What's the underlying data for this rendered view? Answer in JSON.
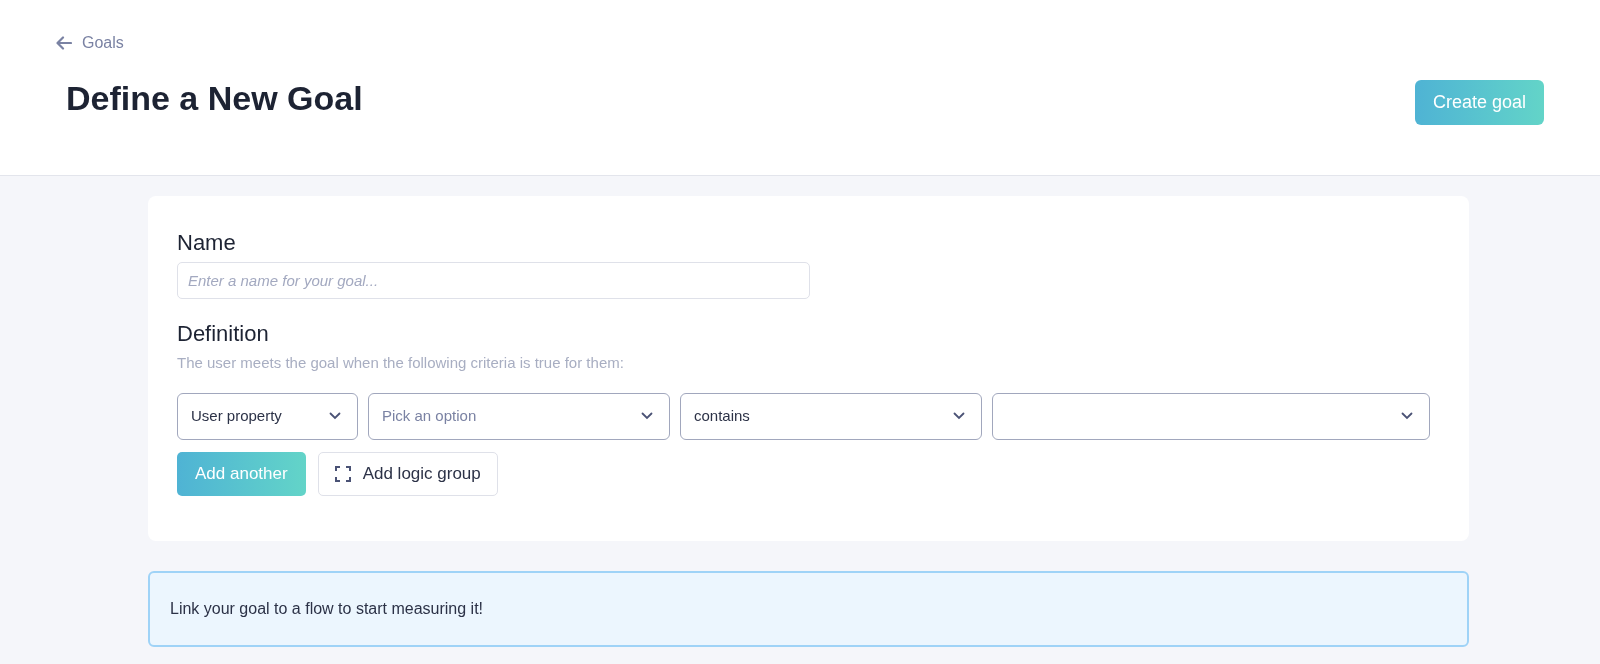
{
  "header": {
    "back_link": "Goals",
    "title": "Define a New Goal",
    "primary_button": "Create goal"
  },
  "form": {
    "name_label": "Name",
    "name_field": {
      "placeholder": "Enter a name for your goal..."
    },
    "definition_label": "Definition",
    "definition_hint": "The user meets the goal when the following criteria is true for them:",
    "criteria": [
      {
        "kind": "select",
        "value": "User property"
      },
      {
        "kind": "select",
        "placeholder": "Pick an option"
      },
      {
        "kind": "select",
        "value": "contains"
      },
      {
        "kind": "select"
      }
    ],
    "buttons": [
      {
        "kind": "primary",
        "label": "Add another"
      },
      {
        "kind": "outline",
        "label": "Add logic group"
      }
    ]
  },
  "banner": {
    "text": "Link your goal to a flow to start measuring it!"
  }
}
